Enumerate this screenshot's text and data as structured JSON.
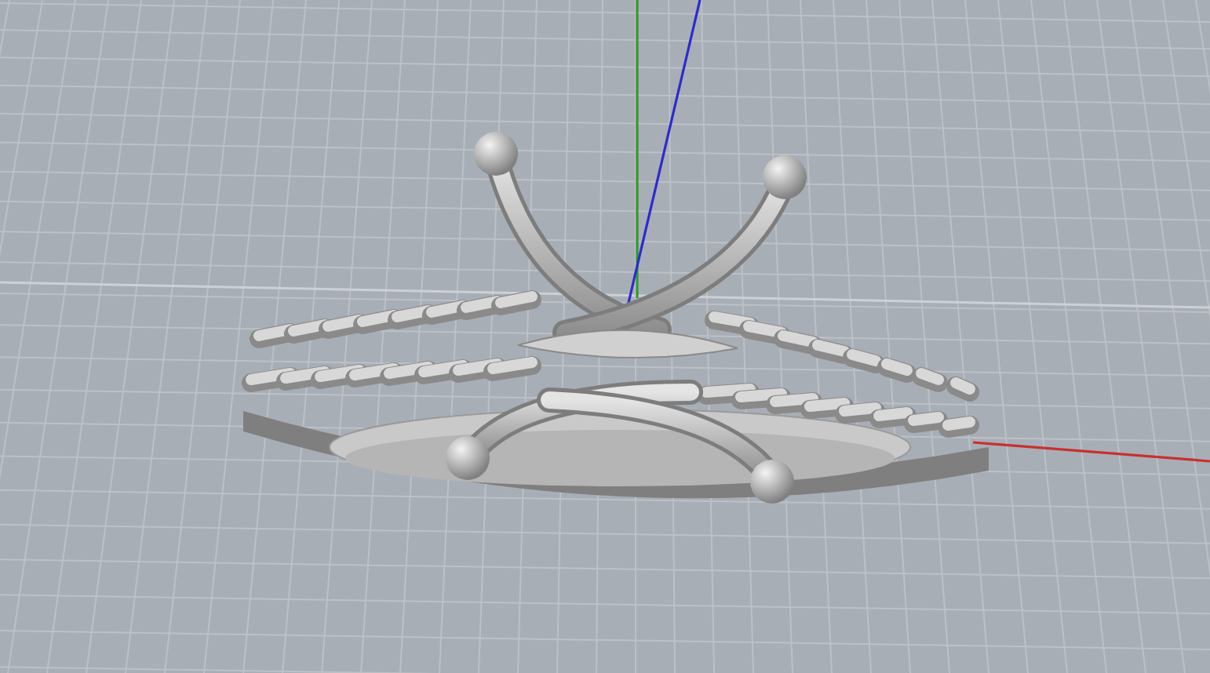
{
  "viewport": {
    "kind": "perspective",
    "axes": [
      {
        "kind": "y",
        "color": "#2f9a2f"
      },
      {
        "kind": "z",
        "color": "#2b2bd0"
      },
      {
        "kind": "x",
        "color": "#c83030"
      }
    ]
  }
}
